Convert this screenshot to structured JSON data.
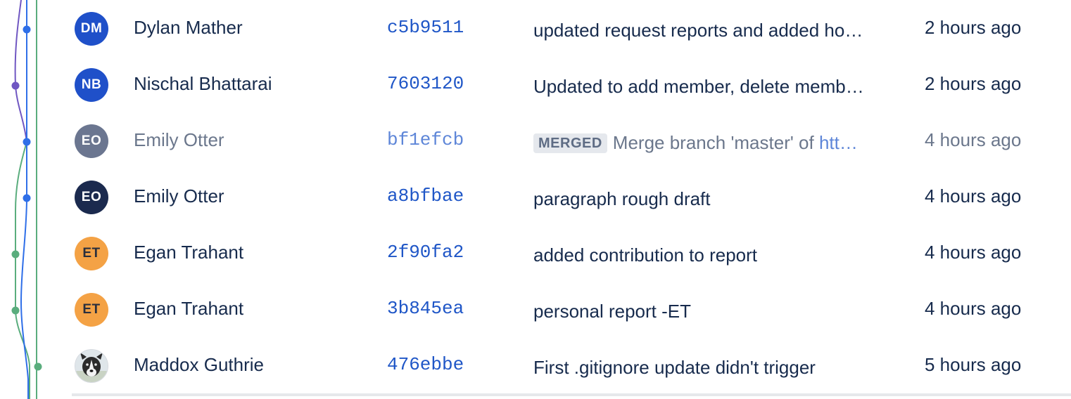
{
  "graph": {
    "colors": {
      "blue": "#2f6fe8",
      "purple": "#7057c2",
      "green": "#5aad7d"
    }
  },
  "commits": [
    {
      "initials": "DM",
      "author": "Dylan Mather",
      "hash": "c5b9511",
      "message": "updated request reports and added ho…",
      "time": "2 hours ago",
      "avatar_color": "#1f50c9"
    },
    {
      "initials": "NB",
      "author": "Nischal Bhattarai",
      "hash": "7603120",
      "message": "Updated to add member, delete memb…",
      "time": "2 hours ago",
      "avatar_color": "#1f50c9"
    },
    {
      "initials": "EO",
      "author": "Emily Otter",
      "hash": "bf1efcb",
      "badge": "MERGED",
      "message": "Merge branch 'master' of ",
      "message_link": "htt…",
      "time": "4 hours ago",
      "avatar_color": "#6b7690"
    },
    {
      "initials": "EO",
      "author": "Emily Otter",
      "hash": "a8bfbae",
      "message": "paragraph rough draft",
      "time": "4 hours ago",
      "avatar_color": "#1b2a4e"
    },
    {
      "initials": "ET",
      "author": "Egan Trahant",
      "hash": "2f90fa2",
      "message": "added contribution to report",
      "time": "4 hours ago",
      "avatar_color": "#f4a245"
    },
    {
      "initials": "ET",
      "author": "Egan Trahant",
      "hash": "3b845ea",
      "message": "personal report -ET",
      "time": "4 hours ago",
      "avatar_color": "#f4a245"
    },
    {
      "author": "Maddox Guthrie",
      "hash": "476ebbe",
      "message": "First .gitignore update didn't trigger",
      "time": "5 hours ago",
      "avatar_icon": "dog-photo-avatar"
    }
  ]
}
